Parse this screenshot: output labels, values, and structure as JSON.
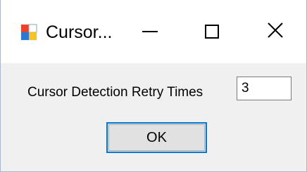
{
  "window": {
    "title": "Cursor...",
    "icon": "windows-forms-app-icon",
    "controls": {
      "minimize_icon": "minimize-icon",
      "maximize_icon": "maximize-icon",
      "close_icon": "close-icon"
    }
  },
  "form": {
    "retry_label": "Cursor Detection Retry Times",
    "retry_value": "3",
    "ok_label": "OK"
  },
  "colors": {
    "client_background": "#f0f0f0",
    "button_focus_border": "#0078d7",
    "button_background": "#e1e1e1"
  }
}
